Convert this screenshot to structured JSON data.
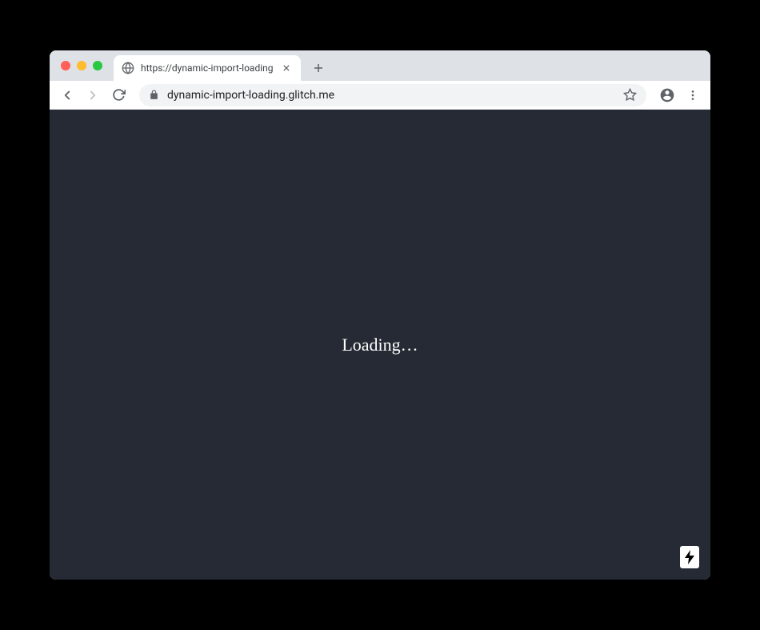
{
  "browser": {
    "tab": {
      "title": "https://dynamic-import-loading",
      "favicon": "globe-icon"
    },
    "toolbar": {
      "url": "dynamic-import-loading.glitch.me"
    }
  },
  "page": {
    "loading_text": "Loading…"
  },
  "colors": {
    "page_bg": "#252a34",
    "page_text": "#ffffff",
    "chrome_tab_bg": "#dee1e6",
    "chrome_toolbar_bg": "#ffffff"
  }
}
